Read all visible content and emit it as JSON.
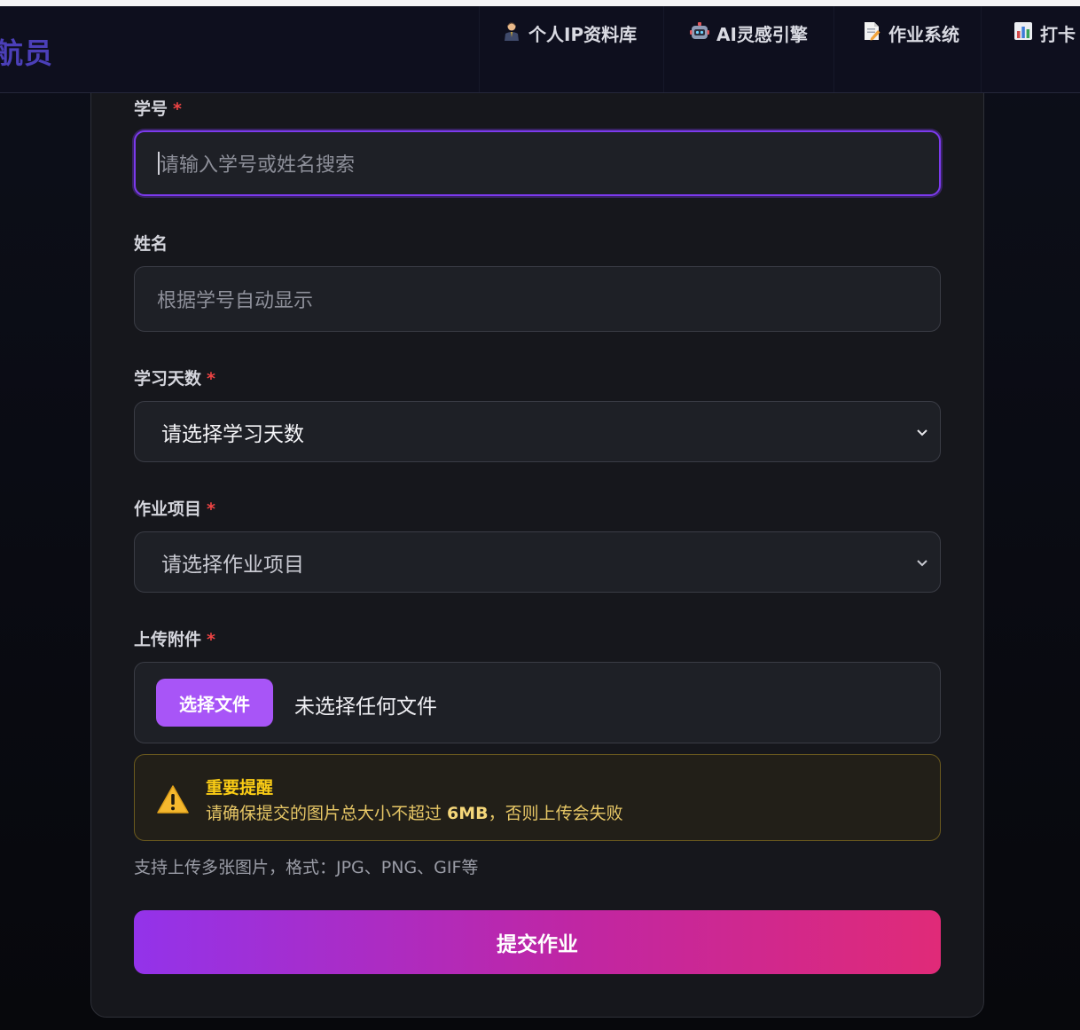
{
  "header": {
    "brand": "航员",
    "nav": [
      {
        "label": "个人IP资料库",
        "icon": "person-icon"
      },
      {
        "label": "AI灵感引擎",
        "icon": "robot-icon"
      },
      {
        "label": "作业系统",
        "icon": "memo-icon"
      },
      {
        "label": "打卡",
        "icon": "bar-chart-icon"
      }
    ]
  },
  "form": {
    "student_id": {
      "label": "学号",
      "required_mark": "*",
      "placeholder": "请输入学号或姓名搜索"
    },
    "name": {
      "label": "姓名",
      "placeholder": "根据学号自动显示"
    },
    "study_days": {
      "label": "学习天数",
      "required_mark": "*",
      "selected": "请选择学习天数"
    },
    "assignment": {
      "label": "作业项目",
      "required_mark": "*",
      "selected": "请选择作业项目"
    },
    "attachment": {
      "label": "上传附件",
      "required_mark": "*",
      "button": "选择文件",
      "status": "未选择任何文件"
    },
    "warning": {
      "title": "重要提醒",
      "text_prefix": "请确保提交的图片总大小不超过 ",
      "size": "6MB",
      "text_suffix": "，否则上传会失败"
    },
    "hint": "支持上传多张图片，格式：JPG、PNG、GIF等",
    "submit": "提交作业"
  },
  "colors": {
    "accent": "#a855f7",
    "focus_border": "#7c3aed",
    "required": "#ef4444",
    "warning": "#facc15",
    "submit_gradient_start": "#9333ea",
    "submit_gradient_end": "#e02a78"
  }
}
